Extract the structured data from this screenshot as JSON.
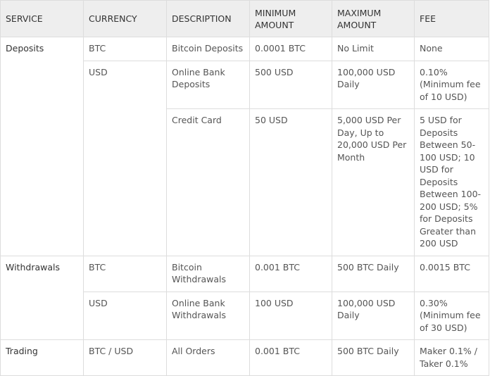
{
  "headers": [
    "SERVICE",
    "CURRENCY",
    "DESCRIPTION",
    "MINIMUM AMOUNT",
    "MAXIMUM AMOUNT",
    "FEE"
  ],
  "deposits": {
    "service": "Deposits",
    "btc": {
      "currency": "BTC",
      "description": "Bitcoin Deposits",
      "min": "0.0001 BTC",
      "max": "No Limit",
      "fee": "None"
    },
    "usd": {
      "currency": "USD",
      "bank": {
        "description": "Online Bank Deposits",
        "min": "500 USD",
        "max": "100,000 USD Daily",
        "fee": "0.10% (Minimum fee of 10 USD)"
      },
      "card": {
        "description": "Credit Card",
        "min": "50 USD",
        "max": "5,000 USD Per Day, Up to 20,000 USD Per Month",
        "fee": "5 USD for Deposits Between 50-100 USD; 10 USD for Deposits Between 100-200 USD; 5% for Deposits Greater than 200 USD"
      }
    }
  },
  "withdrawals": {
    "service": "Withdrawals",
    "btc": {
      "currency": "BTC",
      "description": "Bitcoin Withdrawals",
      "min": "0.001 BTC",
      "max": "500 BTC Daily",
      "fee": "0.0015 BTC"
    },
    "usd": {
      "currency": "USD",
      "description": "Online Bank Withdrawals",
      "min": "100 USD",
      "max": "100,000 USD Daily",
      "fee": "0.30% (Minimum fee of 30 USD)"
    }
  },
  "trading": {
    "service": "Trading",
    "currency": "BTC / USD",
    "description": "All Orders",
    "min": "0.001 BTC",
    "max": "500 BTC Daily",
    "fee": "Maker 0.1% / Taker 0.1%"
  }
}
